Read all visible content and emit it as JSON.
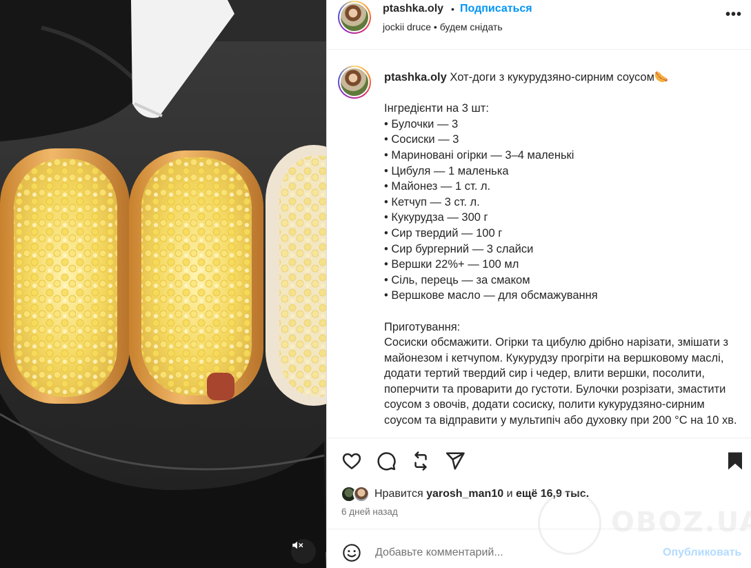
{
  "post": {
    "author": "ptashka.oly",
    "follow_label": "Подписаться",
    "separator": "•",
    "audio": "jockii druce",
    "location": "будем снідать",
    "more_icon": "more-options-icon"
  },
  "caption": {
    "username": "ptashka.oly",
    "title": "Хот-доги з кукурудзяно-сирним соусом🌭",
    "ingredients_header": "Інгредієнти на 3 шт:",
    "ingredients": [
      "• Булочки — 3",
      "• Сосиски — 3",
      "• Мариновані огірки — 3–4 маленькі",
      "• Цибуля — 1 маленька",
      "• Майонез — 1 ст. л.",
      "• Кетчуп — 3 ст. л.",
      "• Кукурудза — 300 г",
      "• Сир твердий — 100 г",
      "• Сир бургерний — 3 слайси",
      "• Вершки 22%+ — 100 мл",
      "• Сіль, перець — за смаком",
      "• Вершкове масло — для обсмажування"
    ],
    "method_header": "Приготування:",
    "method": "Сосиски обсмажити. Огірки та цибулю дрібно нарізати, змішати з майонезом і кетчупом. Кукурудзу прогріти на вершковому маслі, додати тертий твердий сир і чедер, влити вершки, посолити, поперчити та проварити до густоти. Булочки розрізати, змастити соусом з овочів, додати сосиску, полити кукурудзяно-сирним соусом та відправити у мультипіч або духовку при 200 °С на 10 хв."
  },
  "engagement": {
    "likes_prefix": "Нравится",
    "liked_by": "yarosh_man10",
    "likes_connector": "и",
    "likes_rest": "ещё 16,9 тыс.",
    "time_ago": "6 дней назад"
  },
  "comment_box": {
    "placeholder": "Добавьте комментарий...",
    "post_label": "Опубликовать"
  },
  "watermark": {
    "text": "OBOZ.UA"
  },
  "colors": {
    "accent_blue": "#0095f6",
    "disabled_blue": "#b3dbff",
    "text": "#262626",
    "muted": "#737373",
    "border": "#dbdbdb"
  },
  "icons": [
    "heart-icon",
    "comment-icon",
    "repost-icon",
    "share-icon",
    "bookmark-icon",
    "emoji-icon",
    "muted-speaker-icon"
  ]
}
